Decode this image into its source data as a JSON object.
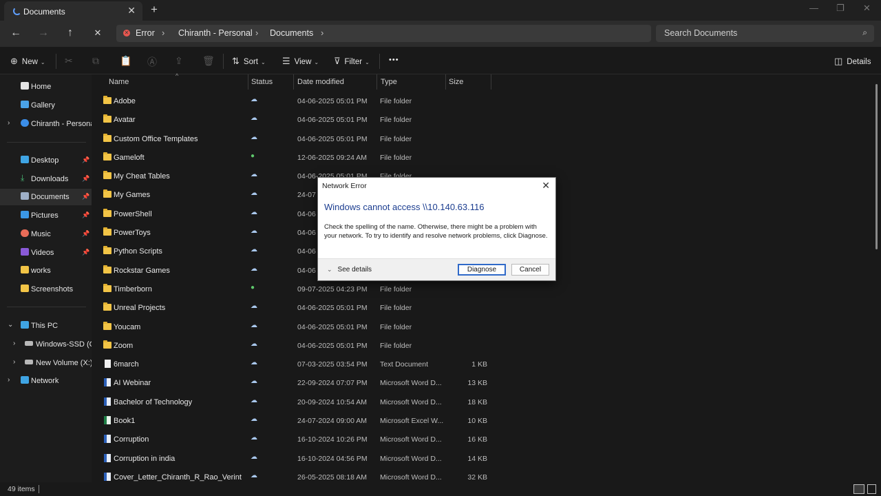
{
  "window": {
    "tab_title": "Documents",
    "close_glyph": "✕",
    "new_tab_glyph": "+",
    "minimize_glyph": "—",
    "maximize_glyph": "❐",
    "window_close_glyph": "✕"
  },
  "nav": {
    "back_glyph": "←",
    "forward_glyph": "→",
    "up_glyph": "↑",
    "stop_glyph": "✕"
  },
  "address": {
    "crumbs": [
      "Error",
      "Chiranth - Personal",
      "Documents"
    ],
    "separator": "›"
  },
  "search": {
    "placeholder": "Search Documents",
    "icon": "⌕"
  },
  "commands": {
    "new": "New",
    "sort": "Sort",
    "view": "View",
    "filter": "Filter",
    "more": "•••",
    "details": "Details",
    "new_icon": "⊕",
    "sort_icon": "⇅",
    "view_icon": "☰",
    "filter_icon": "⊽",
    "details_icon": "◫",
    "chev": "⌄",
    "cut_icon": "✂",
    "copy_icon": "⧉",
    "paste_icon": "📋",
    "rename_icon": "Ⓐ",
    "share_icon": "⇪",
    "delete_icon": "🗑"
  },
  "sidebar": {
    "items": [
      {
        "label": "Home"
      },
      {
        "label": "Gallery"
      },
      {
        "label": "Chiranth - Personal"
      },
      {
        "label": "Desktop"
      },
      {
        "label": "Downloads"
      },
      {
        "label": "Documents"
      },
      {
        "label": "Pictures"
      },
      {
        "label": "Music"
      },
      {
        "label": "Videos"
      },
      {
        "label": "works"
      },
      {
        "label": "Screenshots"
      },
      {
        "label": "This PC"
      },
      {
        "label": "Windows-SSD (C:)"
      },
      {
        "label": "New Volume (X:)"
      },
      {
        "label": "Network"
      }
    ],
    "pin_glyph": "📌",
    "collapsed_glyph": "›",
    "expanded_glyph": "⌄"
  },
  "columns": {
    "name": "Name",
    "status": "Status",
    "date": "Date modified",
    "type": "Type",
    "size": "Size",
    "sort_glyph": "^"
  },
  "files": [
    {
      "name": "Adobe",
      "kind": "folder",
      "status": "cloud",
      "date": "04-06-2025 05:01 PM",
      "type": "File folder",
      "size": ""
    },
    {
      "name": "Avatar",
      "kind": "folder",
      "status": "cloud",
      "date": "04-06-2025 05:01 PM",
      "type": "File folder",
      "size": ""
    },
    {
      "name": "Custom Office Templates",
      "kind": "folder",
      "status": "cloud",
      "date": "04-06-2025 05:01 PM",
      "type": "File folder",
      "size": ""
    },
    {
      "name": "Gameloft",
      "kind": "folder",
      "status": "ok",
      "date": "12-06-2025 09:24 AM",
      "type": "File folder",
      "size": ""
    },
    {
      "name": "My Cheat Tables",
      "kind": "folder",
      "status": "cloud",
      "date": "04-06-2025 05:01 PM",
      "type": "File folder",
      "size": ""
    },
    {
      "name": "My Games",
      "kind": "folder",
      "status": "cloud",
      "date": "24-07",
      "type": "",
      "size": ""
    },
    {
      "name": "PowerShell",
      "kind": "folder",
      "status": "cloud",
      "date": "04-06",
      "type": "",
      "size": ""
    },
    {
      "name": "PowerToys",
      "kind": "folder",
      "status": "cloud",
      "date": "04-06",
      "type": "",
      "size": ""
    },
    {
      "name": "Python Scripts",
      "kind": "folder",
      "status": "cloud",
      "date": "04-06",
      "type": "",
      "size": ""
    },
    {
      "name": "Rockstar Games",
      "kind": "folder",
      "status": "cloud",
      "date": "04-06",
      "type": "",
      "size": ""
    },
    {
      "name": "Timberborn",
      "kind": "folder",
      "status": "ok",
      "date": "09-07-2025 04:23 PM",
      "type": "File folder",
      "size": ""
    },
    {
      "name": "Unreal Projects",
      "kind": "folder",
      "status": "cloud",
      "date": "04-06-2025 05:01 PM",
      "type": "File folder",
      "size": ""
    },
    {
      "name": "Youcam",
      "kind": "folder",
      "status": "cloud",
      "date": "04-06-2025 05:01 PM",
      "type": "File folder",
      "size": ""
    },
    {
      "name": "Zoom",
      "kind": "folder",
      "status": "cloud",
      "date": "04-06-2025 05:01 PM",
      "type": "File folder",
      "size": ""
    },
    {
      "name": "6march",
      "kind": "text",
      "status": "cloud",
      "date": "07-03-2025 03:54 PM",
      "type": "Text Document",
      "size": "1 KB"
    },
    {
      "name": "AI Webinar",
      "kind": "word",
      "status": "cloud",
      "date": "22-09-2024 07:07 PM",
      "type": "Microsoft Word D...",
      "size": "13 KB"
    },
    {
      "name": "Bachelor of Technology",
      "kind": "word",
      "status": "cloud",
      "date": "20-09-2024 10:54 AM",
      "type": "Microsoft Word D...",
      "size": "18 KB"
    },
    {
      "name": "Book1",
      "kind": "excel",
      "status": "cloud",
      "date": "24-07-2024 09:00 AM",
      "type": "Microsoft Excel W...",
      "size": "10 KB"
    },
    {
      "name": "Corruption",
      "kind": "word",
      "status": "cloud",
      "date": "16-10-2024 10:26 PM",
      "type": "Microsoft Word D...",
      "size": "16 KB"
    },
    {
      "name": "Corruption in india",
      "kind": "word",
      "status": "cloud",
      "date": "16-10-2024 04:56 PM",
      "type": "Microsoft Word D...",
      "size": "14 KB"
    },
    {
      "name": "Cover_Letter_Chiranth_R_Rao_Verint",
      "kind": "word",
      "status": "cloud",
      "date": "26-05-2025 08:18 AM",
      "type": "Microsoft Word D...",
      "size": "32 KB"
    }
  ],
  "status": {
    "item_count": "49 items"
  },
  "dialog": {
    "title": "Network Error",
    "heading": "Windows cannot access \\\\10.140.63.116",
    "message": "Check the spelling of the name. Otherwise, there might be a problem with your network. To try to identify and resolve network problems, click Diagnose.",
    "see_details": "See details",
    "diagnose": "Diagnose",
    "cancel": "Cancel",
    "close_glyph": "✕",
    "chev": "⌄"
  },
  "colors": {
    "folder": "#f2c446",
    "accent": "#2f69c9",
    "error": "#e8564f",
    "cloud_status": "#a9c8ee",
    "ok_status": "#5ec86c"
  }
}
